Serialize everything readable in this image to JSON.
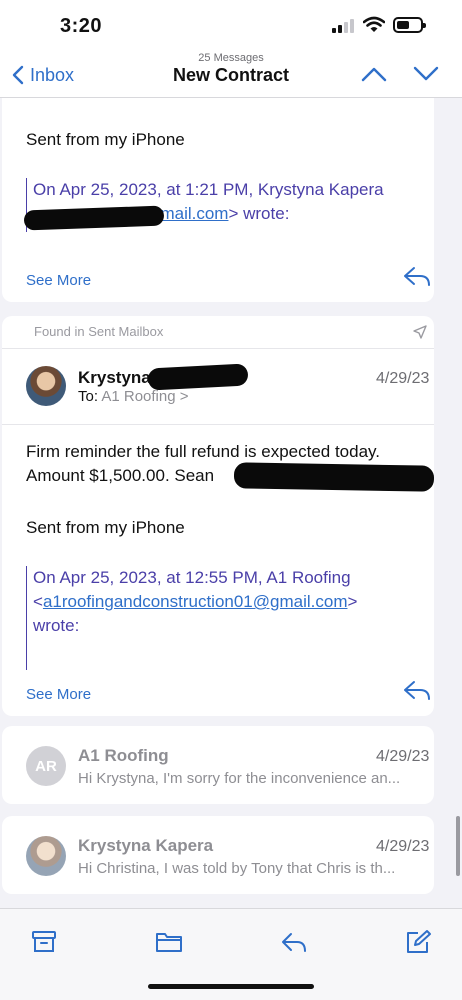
{
  "status_bar": {
    "time": "3:20",
    "icons": [
      "cellular-signal-icon",
      "wifi-icon",
      "battery-icon"
    ]
  },
  "nav": {
    "back_label": "Inbox",
    "message_count": "25 Messages",
    "title": "New Contract",
    "icons": [
      "chevron-left-icon",
      "chevron-up-icon",
      "chevron-down-icon"
    ]
  },
  "message1": {
    "body": "Sent from my iPhone",
    "quote_line1": "On Apr 25, 2023, at 1:21 PM, Krystyna Kapera",
    "quote_email_visible": "gmail.com",
    "quote_suffix": "> wrote:",
    "see_more": "See More"
  },
  "message2": {
    "found_label": "Found in Sent Mailbox",
    "sender": "Krystyna",
    "date": "4/29/23",
    "to_label": "To:",
    "recipient": "A1 Roofing >",
    "body_line1": "Firm reminder the full refund is expected today.",
    "body_line2": "Amount $1,500.00. Sean",
    "signature": "Sent from my iPhone",
    "quote_line1": "On Apr 25, 2023, at 12:55 PM, A1 Roofing",
    "quote_open": "<",
    "quote_email": "a1roofingandconstruction01@gmail.com",
    "quote_close": ">",
    "quote_line3": "wrote:",
    "see_more": "See More"
  },
  "message3": {
    "avatar_initials": "AR",
    "sender": "A1 Roofing",
    "date": "4/29/23",
    "preview": "Hi Krystyna, I'm sorry for the inconvenience an..."
  },
  "message4": {
    "sender": "Krystyna Kapera",
    "date": "4/29/23",
    "preview": "Hi Christina, I was told by Tony that Chris is th..."
  },
  "toolbar": {
    "icons": [
      "archive-icon",
      "folder-icon",
      "reply-icon",
      "compose-icon"
    ]
  },
  "colors": {
    "accent": "#2f6fc9",
    "quote": "#4a3fa8",
    "secondary_text": "#8e8e93",
    "background": "#f2f2f7"
  }
}
